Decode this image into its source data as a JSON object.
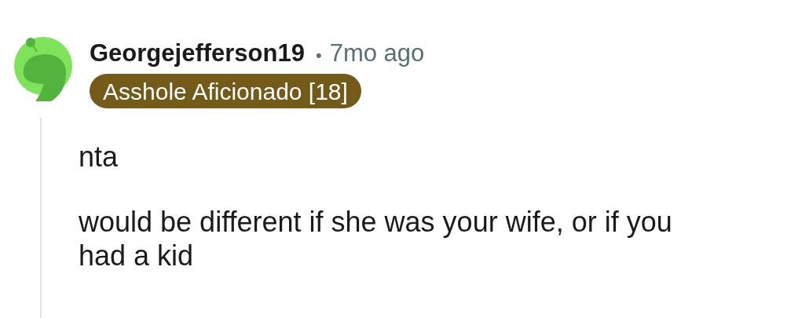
{
  "comment": {
    "author": "Georgejefferson19",
    "separator": "•",
    "time": "7mo ago",
    "flair": {
      "text": "Asshole Aficionado [18]",
      "color": "#735a19"
    },
    "paragraphs": [
      "nta",
      "would be different if she was your wife, or if you had a kid"
    ]
  }
}
